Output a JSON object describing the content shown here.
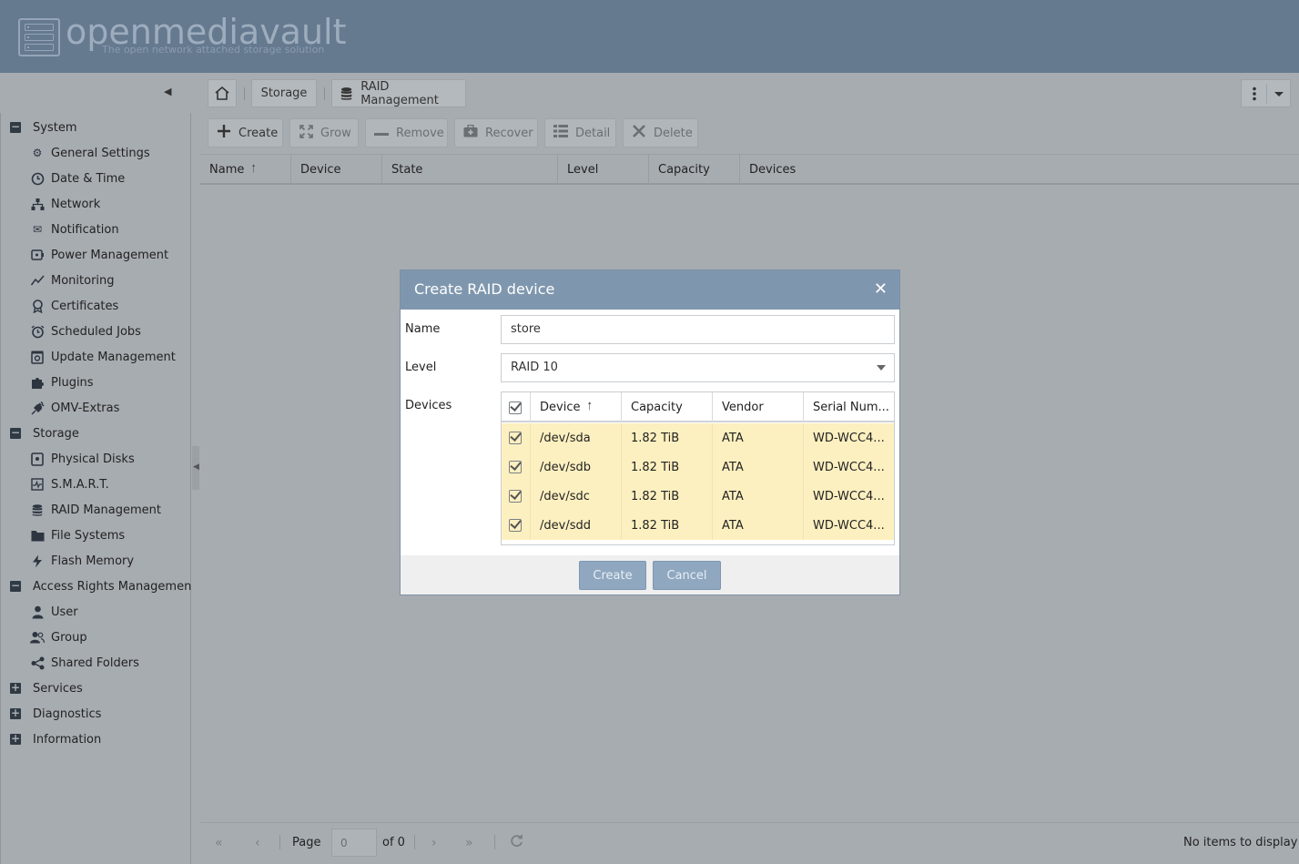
{
  "header": {
    "logo_title": "openmediavault",
    "logo_subtitle": "The open network attached storage solution"
  },
  "breadcrumb": {
    "home_icon": "home-icon",
    "items": [
      {
        "label": "Storage"
      },
      {
        "label": "RAID Management",
        "icon": "database-icon"
      }
    ]
  },
  "sidebar": {
    "groups": [
      {
        "label": "System",
        "expanded": true,
        "items": [
          {
            "label": "General Settings",
            "icon": "gears-icon"
          },
          {
            "label": "Date & Time",
            "icon": "clock-icon"
          },
          {
            "label": "Network",
            "icon": "sitemap-icon"
          },
          {
            "label": "Notification",
            "icon": "envelope-icon"
          },
          {
            "label": "Power Management",
            "icon": "power-icon"
          },
          {
            "label": "Monitoring",
            "icon": "chart-line-icon"
          },
          {
            "label": "Certificates",
            "icon": "certificate-icon"
          },
          {
            "label": "Scheduled Jobs",
            "icon": "alarm-clock-icon"
          },
          {
            "label": "Update Management",
            "icon": "update-icon"
          },
          {
            "label": "Plugins",
            "icon": "puzzle-icon"
          },
          {
            "label": "OMV-Extras",
            "icon": "plug-icon"
          }
        ]
      },
      {
        "label": "Storage",
        "expanded": true,
        "items": [
          {
            "label": "Physical Disks",
            "icon": "disk-icon"
          },
          {
            "label": "S.M.A.R.T.",
            "icon": "smart-icon"
          },
          {
            "label": "RAID Management",
            "icon": "database-icon"
          },
          {
            "label": "File Systems",
            "icon": "folder-icon"
          },
          {
            "label": "Flash Memory",
            "icon": "flash-icon"
          }
        ]
      },
      {
        "label": "Access Rights Management",
        "expanded": true,
        "items": [
          {
            "label": "User",
            "icon": "user-icon"
          },
          {
            "label": "Group",
            "icon": "users-icon"
          },
          {
            "label": "Shared Folders",
            "icon": "share-icon"
          }
        ]
      },
      {
        "label": "Services",
        "expanded": false,
        "items": []
      },
      {
        "label": "Diagnostics",
        "expanded": false,
        "items": []
      },
      {
        "label": "Information",
        "expanded": false,
        "items": []
      }
    ]
  },
  "toolbar": {
    "create": "Create",
    "grow": "Grow",
    "remove": "Remove",
    "recover": "Recover",
    "detail": "Detail",
    "delete": "Delete"
  },
  "grid": {
    "columns": [
      "Name",
      "Device",
      "State",
      "Level",
      "Capacity",
      "Devices"
    ],
    "sort_column": "Name"
  },
  "pager": {
    "page_label": "Page",
    "page_value": "0",
    "of_label": "of 0",
    "status": "No items to display"
  },
  "dialog": {
    "title": "Create RAID device",
    "name_label": "Name",
    "name_value": "store",
    "level_label": "Level",
    "level_value": "RAID 10",
    "devices_label": "Devices",
    "device_columns": [
      "Device",
      "Capacity",
      "Vendor",
      "Serial Num..."
    ],
    "devices": [
      {
        "device": "/dev/sda",
        "capacity": "1.82 TiB",
        "vendor": "ATA",
        "serial": "WD-WCC4...",
        "checked": true
      },
      {
        "device": "/dev/sdb",
        "capacity": "1.82 TiB",
        "vendor": "ATA",
        "serial": "WD-WCC4...",
        "checked": true
      },
      {
        "device": "/dev/sdc",
        "capacity": "1.82 TiB",
        "vendor": "ATA",
        "serial": "WD-WCC4...",
        "checked": true
      },
      {
        "device": "/dev/sdd",
        "capacity": "1.82 TiB",
        "vendor": "ATA",
        "serial": "WD-WCC4...",
        "checked": true
      }
    ],
    "create_label": "Create",
    "cancel_label": "Cancel"
  },
  "colors": {
    "header_bg": "#65798f",
    "overlay_bg": "#a7acb1",
    "dialog_header": "#7f97ae",
    "selected_row": "#fdf0c0",
    "button_disabled": "#8fa8c0"
  }
}
